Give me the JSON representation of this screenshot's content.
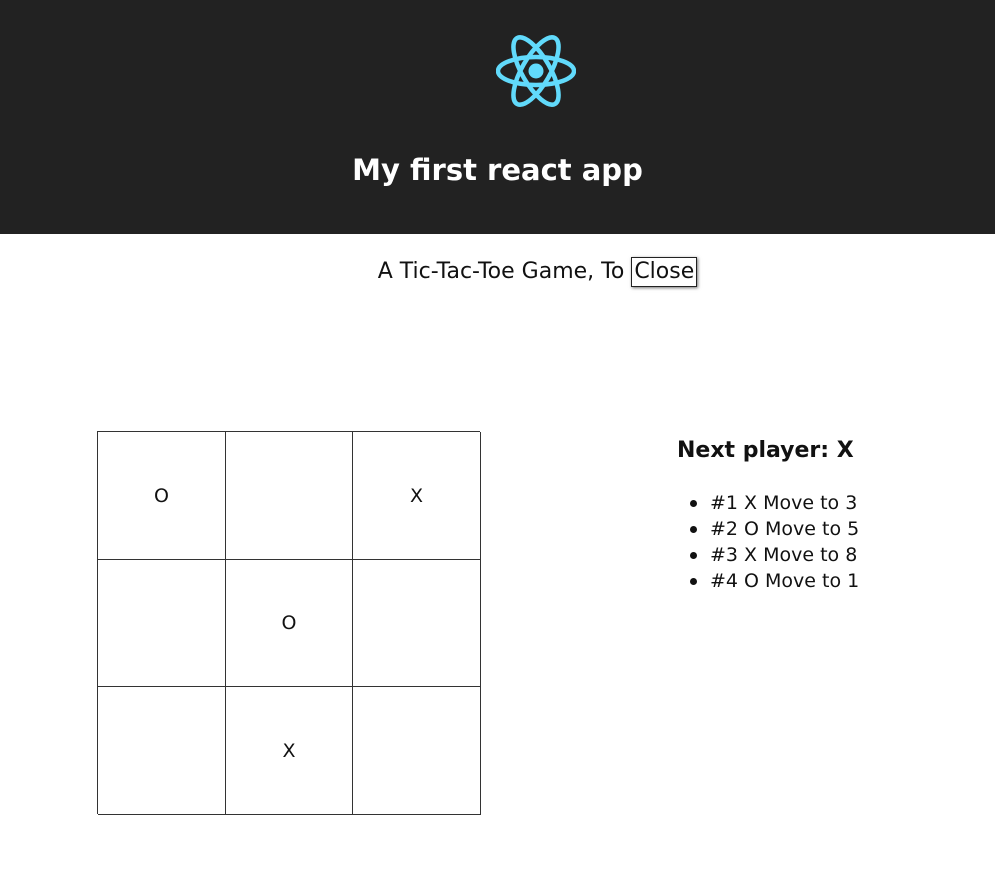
{
  "header": {
    "logo_icon": "react-atom-icon",
    "logo_color": "#61dafb",
    "background": "#222222",
    "title": "My first react app"
  },
  "intro": {
    "text": "A Tic-Tac-Toe Game, To",
    "close_label": "Close"
  },
  "board": {
    "squares": [
      "O",
      "",
      "X",
      "",
      "O",
      "",
      "",
      "X",
      ""
    ]
  },
  "game_info": {
    "status": "Next player: X",
    "moves": [
      "#1 X Move to 3",
      "#2 O Move to 5",
      "#3 X Move to 8",
      "#4 O Move to 1"
    ]
  }
}
